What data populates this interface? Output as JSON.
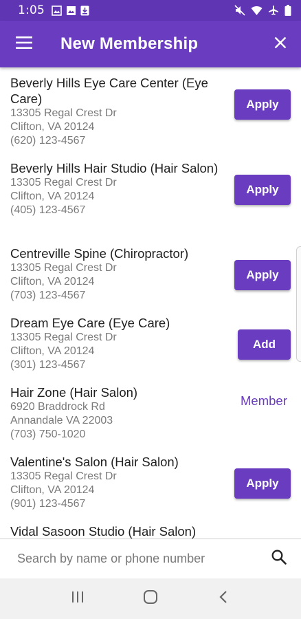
{
  "status_bar": {
    "time": "1:05",
    "left_icons": [
      "image-icon",
      "photo-icon",
      "download-icon"
    ],
    "right_icons": [
      "mute-icon",
      "wifi-icon",
      "airplane-icon",
      "battery-icon"
    ]
  },
  "app_bar": {
    "title": "New Membership",
    "menu_icon": "hamburger-menu-icon",
    "close_icon": "close-icon"
  },
  "memberships": [
    {
      "name": "Beverly Hills Eye Care Center (Eye Care)",
      "address": "13305 Regal Crest Dr",
      "city": "Clifton, VA 20124",
      "phone": "(620) 123-4567",
      "action": "Apply"
    },
    {
      "name": "Beverly Hills Hair Studio (Hair Salon)",
      "address": "13305 Regal Crest Dr",
      "city": "Clifton, VA 20124",
      "phone": "(405) 123-4567",
      "action": "Apply"
    },
    {
      "name": "Centreville Spine (Chiropractor)",
      "address": "13305 Regal Crest Dr",
      "city": "Clifton, VA 20124",
      "phone": "(703) 123-4567",
      "action": "Apply"
    },
    {
      "name": "Dream Eye Care (Eye Care)",
      "address": "13305 Regal Crest Dr",
      "city": "Clifton, VA 20124",
      "phone": "(301) 123-4567",
      "action": "Add"
    },
    {
      "name": "Hair Zone (Hair Salon)",
      "address": "6920 Braddrock Rd",
      "city": "Annandale VA 22003",
      "phone": "(703) 750-1020",
      "action": "Member"
    },
    {
      "name": "Valentine's Salon (Hair Salon)",
      "address": "13305 Regal Crest Dr",
      "city": "Clifton, VA 20124",
      "phone": "(901) 123-4567",
      "action": "Apply"
    },
    {
      "name": "Vidal Sasoon Studio (Hair Salon)"
    }
  ],
  "search": {
    "placeholder": "Search by name or phone number",
    "icon": "search-icon"
  },
  "nav_bar": {
    "icons": [
      "recent-apps-icon",
      "home-icon",
      "back-icon"
    ]
  },
  "colors": {
    "primary": "#6a3cbf",
    "status_bar": "#5f35b4",
    "secondary_text": "#7a7a7a"
  }
}
